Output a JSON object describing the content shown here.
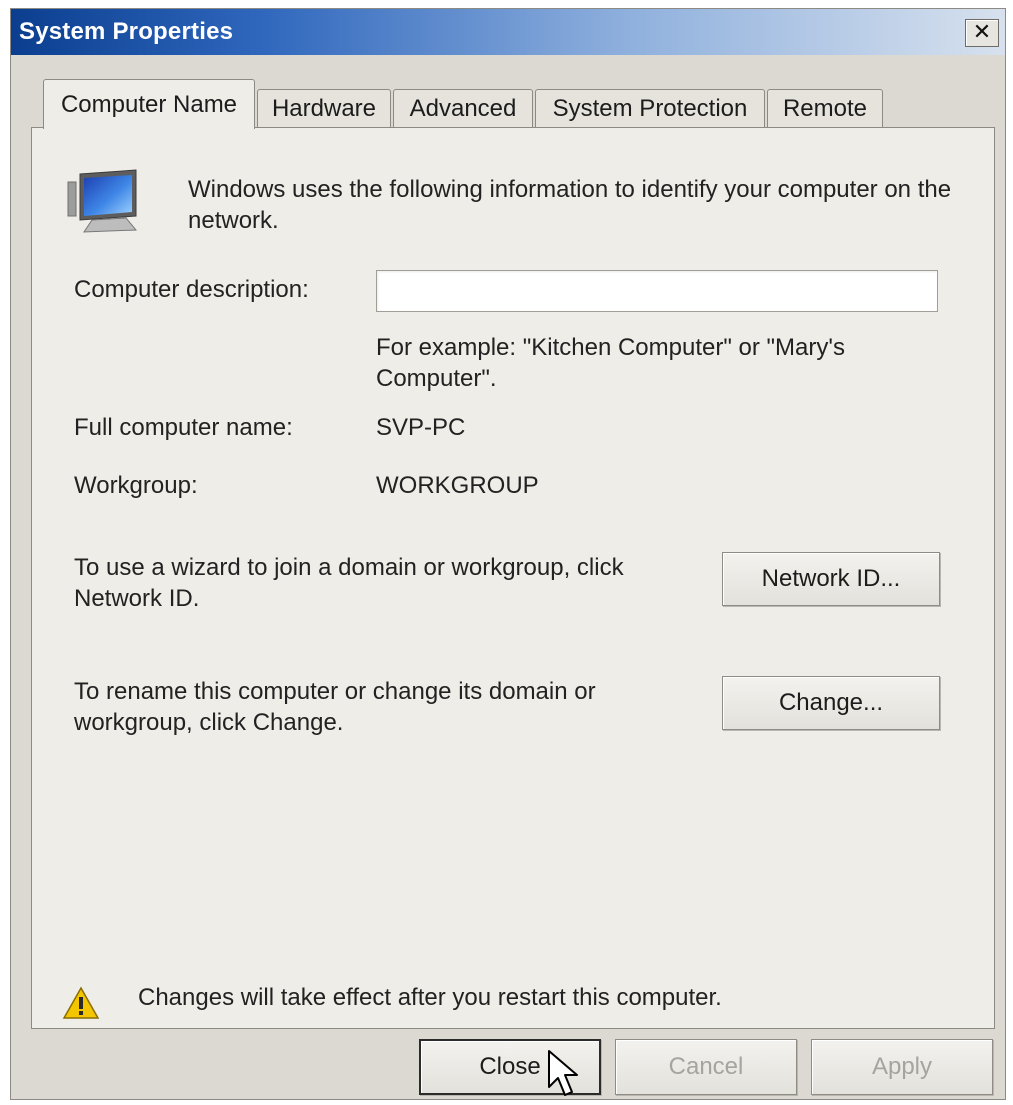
{
  "window": {
    "title": "System Properties",
    "close_glyph": "✕",
    "title_gradient": [
      "#0b3e8f",
      "#d7e1ee"
    ]
  },
  "tabs": [
    {
      "label": "Computer Name",
      "active": true
    },
    {
      "label": "Hardware",
      "active": false
    },
    {
      "label": "Advanced",
      "active": false
    },
    {
      "label": "System Protection",
      "active": false
    },
    {
      "label": "Remote",
      "active": false
    }
  ],
  "computer_name_tab": {
    "intro_text": "Windows uses the following information to identify your computer on the network.",
    "description_label": "Computer description:",
    "description_value": "",
    "example_text": "For example: \"Kitchen Computer\" or \"Mary's Computer\".",
    "full_name_label": "Full computer name:",
    "full_name_value": "SVP-PC",
    "workgroup_label": "Workgroup:",
    "workgroup_value": "WORKGROUP",
    "network_id_text": "To use a wizard to join a domain or workgroup, click Network ID.",
    "network_id_button": "Network ID...",
    "rename_text": "To rename this computer or change its domain or workgroup, click Change.",
    "change_button": "Change...",
    "warning_text": "Changes will take effect after you restart this computer."
  },
  "footer": {
    "close_button": "Close",
    "cancel_button": "Cancel",
    "apply_button": "Apply",
    "cancel_disabled": true,
    "apply_disabled": true
  },
  "icons": {
    "monitor": "computer-monitor-icon",
    "warning": "warning-icon",
    "cursor": "mouse-pointer-icon",
    "warning_color": "#f3c600"
  }
}
